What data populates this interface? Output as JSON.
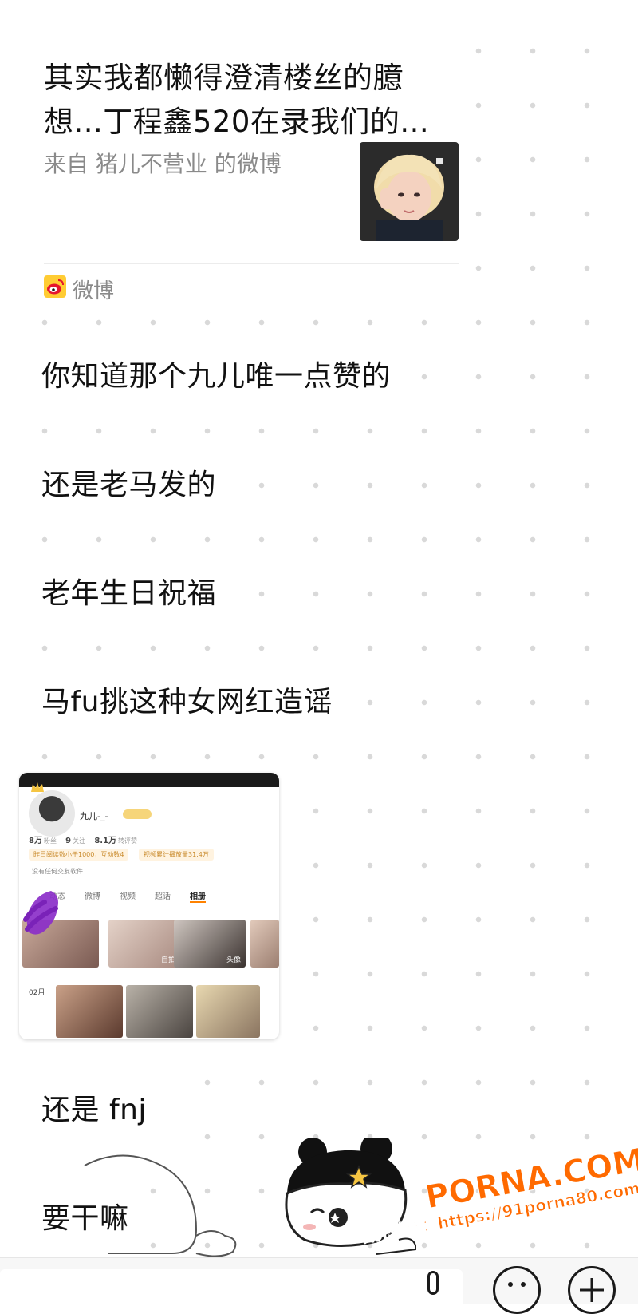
{
  "share_card": {
    "title": "其实我都懒得澄清楼丝的臆想...丁程鑫520在录我们的...",
    "source": "来自 猪儿不营业 的微博",
    "brand_label": "微博"
  },
  "messages": [
    {
      "text": "你知道那个九儿唯一点赞的"
    },
    {
      "text": "还是老马发的"
    },
    {
      "text": "老年生日祝福"
    },
    {
      "text": "马fu挑这种女网红造谣"
    },
    {
      "text": "还是 fnj"
    },
    {
      "text": "要干嘛"
    }
  ],
  "image_message": {
    "profile_name": "九儿-_-",
    "stats": [
      {
        "value": "8万",
        "label": "粉丝"
      },
      {
        "value": "9",
        "label": "关注"
      },
      {
        "value": "8.1万",
        "label": "转评赞"
      }
    ],
    "tags": [
      "昨日阅读数小于1000，互动数4",
      "视频累计播放量31.4万"
    ],
    "note": "没有任何交友软件",
    "tabs": [
      "动态",
      "微博",
      "视频",
      "超话",
      "相册"
    ],
    "active_tab": "相册",
    "photo_labels": [
      "自拍",
      "头像"
    ],
    "month": "02月"
  },
  "watermark": {
    "line1": "PORNA.COM",
    "line2": "看完整版：https://91porna80.com"
  },
  "colors": {
    "weibo_orange": "#ff8200",
    "watermark_orange": "#ff6a00"
  }
}
